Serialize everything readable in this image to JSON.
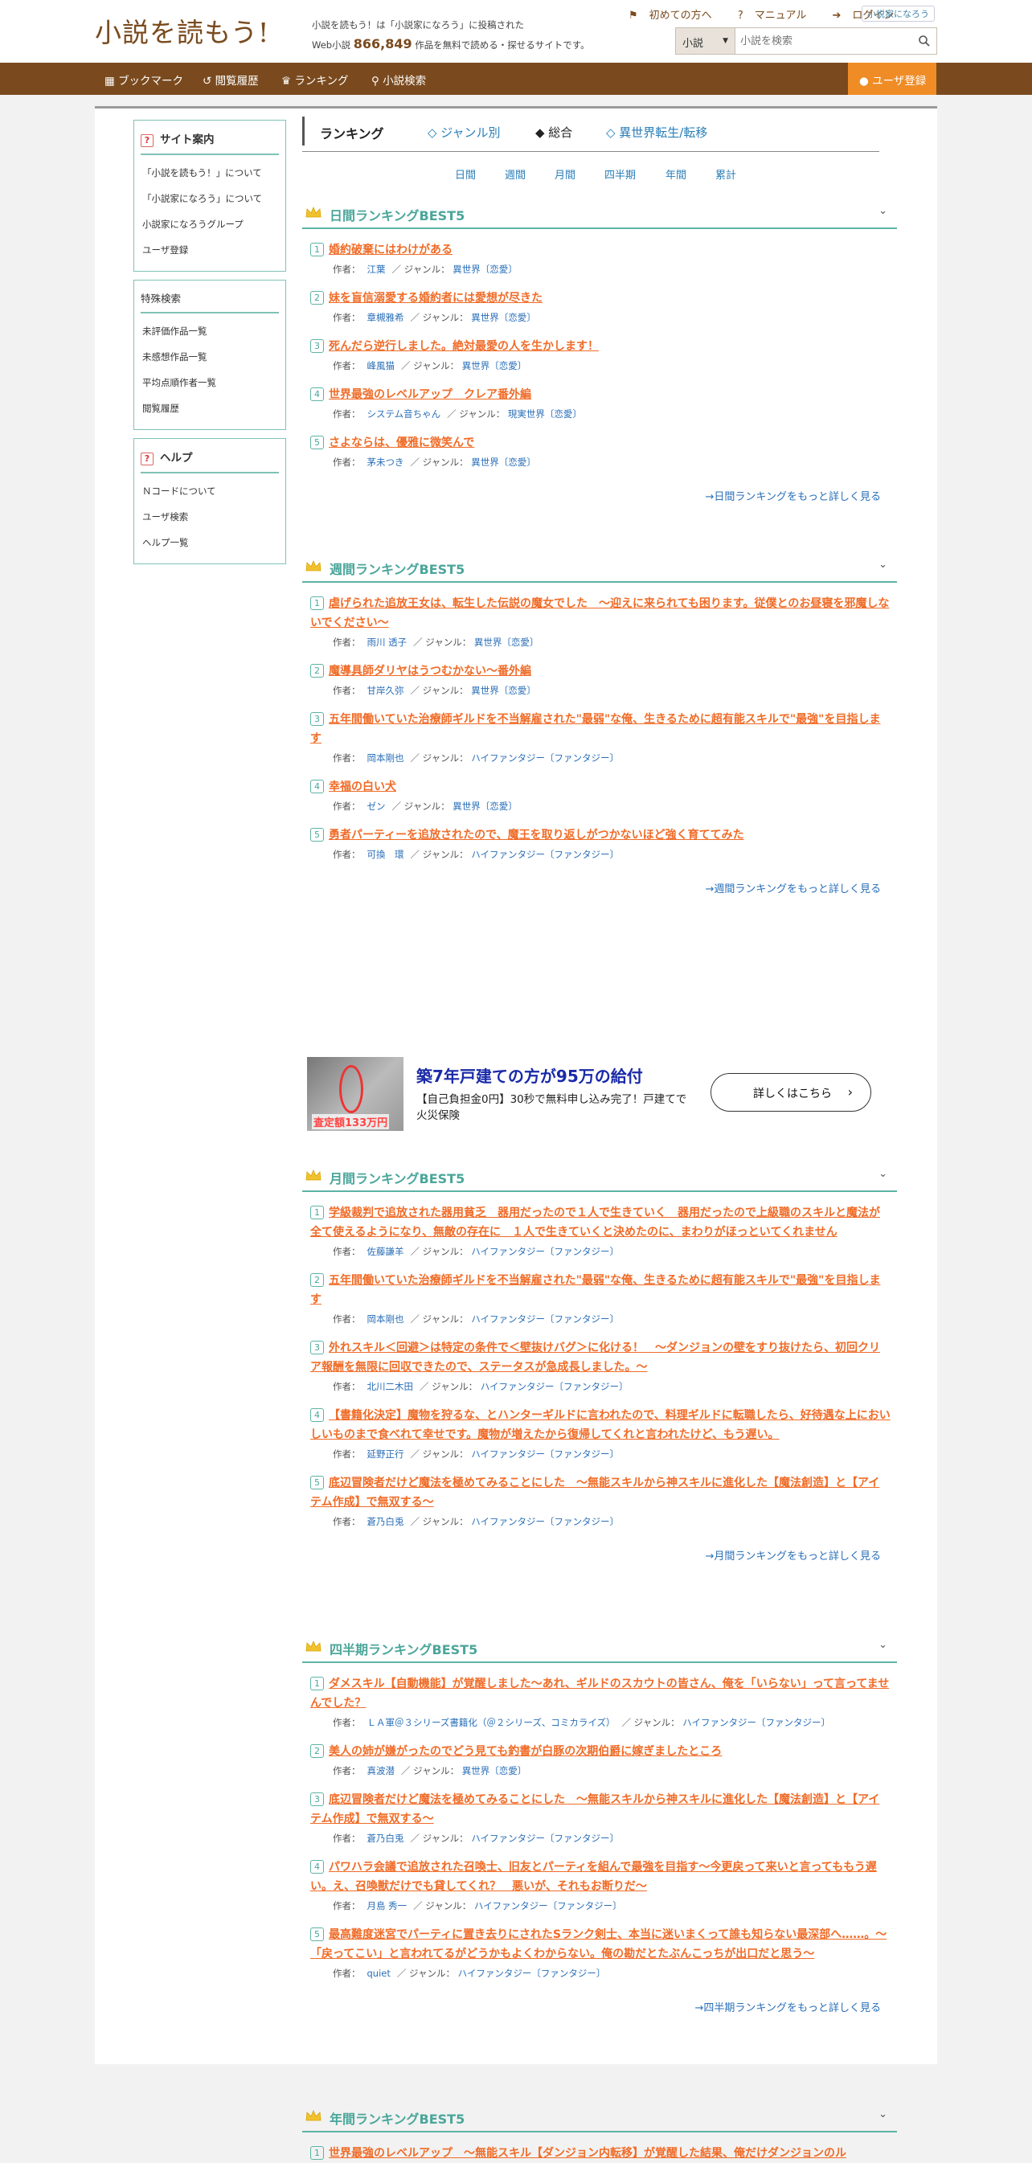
{
  "header": {
    "logo": "小説を読もう!",
    "tagline_line1": "小説を読もう！は「小説家になろう」に投稿された",
    "tagline_prefix": "Web小説",
    "work_count": "866,849",
    "tagline_suffix": "作品を無料で読める・探せるサイトです。",
    "links": {
      "first": "初めての方へ",
      "manual": "マニュアル",
      "login": "ログイン"
    },
    "brand_small": "小説家になろう",
    "search": {
      "category": "小説",
      "placeholder": "小説を検索"
    }
  },
  "nav": {
    "bookmark": "ブックマーク",
    "history": "閲覧履歴",
    "ranking": "ランキング",
    "search": "小説検索",
    "user_register": "ユーザ登録"
  },
  "sidebar": {
    "site_guide": {
      "title": "サイト案内",
      "items": [
        "「小説を読もう！」について",
        "「小説家になろう」について",
        "小説家になろうグループ",
        "ユーザ登録"
      ]
    },
    "special": {
      "title": "特殊検索",
      "items": [
        "未評価作品一覧",
        "未感想作品一覧",
        "平均点順作者一覧",
        "閲覧履歴"
      ]
    },
    "help": {
      "title": "ヘルプ",
      "items": [
        "Ｎコードについて",
        "ユーザ検索",
        "ヘルプ一覧"
      ]
    }
  },
  "tabs": {
    "label": "ランキング",
    "genre": "◇ ジャンル別",
    "overall": "◆ 総合",
    "isekai": "◇ 異世界転生/転移"
  },
  "periods": [
    "日間",
    "週間",
    "月間",
    "四半期",
    "年間",
    "累計"
  ],
  "meta_labels": {
    "author": "作者：",
    "genre": "／ ジャンル："
  },
  "sections": [
    {
      "title": "日間ランキングBEST5",
      "more": "→日間ランキングをもっと詳しく見る",
      "items": [
        {
          "rank": "1",
          "title": "婚約破棄にはわけがある",
          "author": "江葉",
          "genre": "異世界〔恋愛〕"
        },
        {
          "rank": "2",
          "title": "妹を盲信溺愛する婚約者には愛想が尽きた",
          "author": "章槻雅希",
          "genre": "異世界〔恋愛〕"
        },
        {
          "rank": "3",
          "title": "死んだら逆行しました。絶対最愛の人を生かします！",
          "author": "峰風猫",
          "genre": "異世界〔恋愛〕"
        },
        {
          "rank": "4",
          "title": "世界最強のレベルアップ　クレア番外編",
          "author": "システム音ちゃん",
          "genre": "現実世界〔恋愛〕"
        },
        {
          "rank": "5",
          "title": "さよならは、優雅に微笑んで",
          "author": "茅未つき",
          "genre": "異世界〔恋愛〕"
        }
      ]
    },
    {
      "title": "週間ランキングBEST5",
      "more": "→週間ランキングをもっと詳しく見る",
      "items": [
        {
          "rank": "1",
          "title": "虐げられた追放王女は、転生した伝説の魔女でした　～迎えに来られても困ります。従僕とのお昼寝を邪魔しないでください～",
          "author": "雨川 透子",
          "genre": "異世界〔恋愛〕"
        },
        {
          "rank": "2",
          "title": "魔導具師ダリヤはうつむかない～番外編",
          "author": "甘岸久弥",
          "genre": "異世界〔恋愛〕"
        },
        {
          "rank": "3",
          "title": "五年間働いていた治療師ギルドを不当解雇された\"最弱\"な俺、生きるために超有能スキルで\"最強\"を目指します",
          "author": "岡本剛也",
          "genre": "ハイファンタジー〔ファンタジー〕"
        },
        {
          "rank": "4",
          "title": "幸福の白い犬",
          "author": "ゼン",
          "genre": "異世界〔恋愛〕"
        },
        {
          "rank": "5",
          "title": "勇者パーティーを追放されたので、魔王を取り返しがつかないほど強く育ててみた",
          "author": "可換　環",
          "genre": "ハイファンタジー〔ファンタジー〕"
        }
      ]
    },
    {
      "title": "月間ランキングBEST5",
      "more": "→月間ランキングをもっと詳しく見る",
      "items": [
        {
          "rank": "1",
          "title": "学級裁判で追放された器用貧乏　器用だったので１人で生きていく　器用だったので上級職のスキルと魔法が全て使えるようになり、無敵の存在に　１人で生きていくと決めたのに、まわりがほっとい​てくれません",
          "author": "佐藤謙羊",
          "genre": "ハイファンタジー〔ファンタジー〕"
        },
        {
          "rank": "2",
          "title": "五年間働いていた治療師ギルドを不当解雇された\"最弱\"な俺、生きるために超有能スキルで\"最強\"を目指します",
          "author": "岡本剛也",
          "genre": "ハイファンタジー〔ファンタジー〕"
        },
        {
          "rank": "3",
          "title": "外れスキル＜回避＞は特定の条件で＜壁抜けバグ＞に化ける！　～ダンジョンの壁をすり抜けたら、初回クリア報酬を無限に回収できたので、ステータスが急成長しました。～",
          "author": "北川二木田",
          "genre": "ハイファンタジー〔ファンタジー〕"
        },
        {
          "rank": "4",
          "title": "【書籍化決定】魔物を狩るな、とハンターギルドに言われたので、料理ギルドに転職したら、好待遇な上においしいものまで食べれて幸せです。魔物が増えたから復帰してくれと言われたけど、もう遅い。",
          "author": "延野正行",
          "genre": "ハイファンタジー〔ファンタジー〕"
        },
        {
          "rank": "5",
          "title": "底辺冒険者だけど魔法を極めてみることにした　～無能スキルから神スキルに進化した【魔法創造】と【アイテム作成】で無双する～",
          "author": "蒼乃白兎",
          "genre": "ハイファンタジー〔ファンタジー〕"
        }
      ]
    },
    {
      "title": "四半期ランキングBEST5",
      "more": "→四半期ランキングをもっと詳しく見る",
      "items": [
        {
          "rank": "1",
          "title": "ダメスキル【自動機能】が覚醒しました～あれ、ギルドのスカウトの皆さん、俺を「いらない」って言ってませんでした？",
          "author": "ＬＡ軍＠３シリーズ書籍化（＠２シリーズ、コミカライズ）",
          "genre": "ハイファンタジー〔ファンタジー〕"
        },
        {
          "rank": "2",
          "title": "美人の姉が嫌がったのでどう見ても釣書が白豚の次期伯爵に嫁ぎましたところ",
          "author": "真波潜",
          "genre": "異世界〔恋愛〕"
        },
        {
          "rank": "3",
          "title": "底辺冒険者だけど魔法を極めてみることにした　～無能スキルから神スキルに進化した【魔法創造】と【アイテム作成】で無双する～",
          "author": "蒼乃白兎",
          "genre": "ハイファンタジー〔ファンタジー〕"
        },
        {
          "rank": "4",
          "title": "パワハラ会議で追放された召喚士、旧友とパーティを組んで最強を目指す～今更戻って来いと言ってももう遅い。え、召喚獣だけでも貸してくれ？　悪いが、それもお断りだ～",
          "author": "月島 秀一",
          "genre": "ハイファンタジー〔ファンタジー〕"
        },
        {
          "rank": "5",
          "title": "最高難度迷宮でパーティに置き去りにされたSランク剣士、本当に迷いまくって誰も知らない最深部へ……。～「戻ってこい」と言われてるがどうかもよくわからない。俺の勘だとたぶんこっちが出口だと思う～",
          "author": "quiet",
          "genre": "ハイファンタジー〔ファンタジー〕"
        }
      ]
    },
    {
      "title": "年間ランキングBEST5",
      "more": "",
      "items": [
        {
          "rank": "1",
          "title": "世界最強のレベルアップ　～無能スキル【ダンジョン内転移】が覚醒した結果、俺だけダンジョンのル",
          "author": "",
          "genre": ""
        }
      ]
    }
  ],
  "ad": {
    "title": "築7年戸建ての方が95万の給付",
    "description": "【自己負担金0円】30秒で無料申し込み完了！戸建てで火災保険",
    "button": "詳しくはこちら",
    "image_badge": "査定額133万円"
  }
}
